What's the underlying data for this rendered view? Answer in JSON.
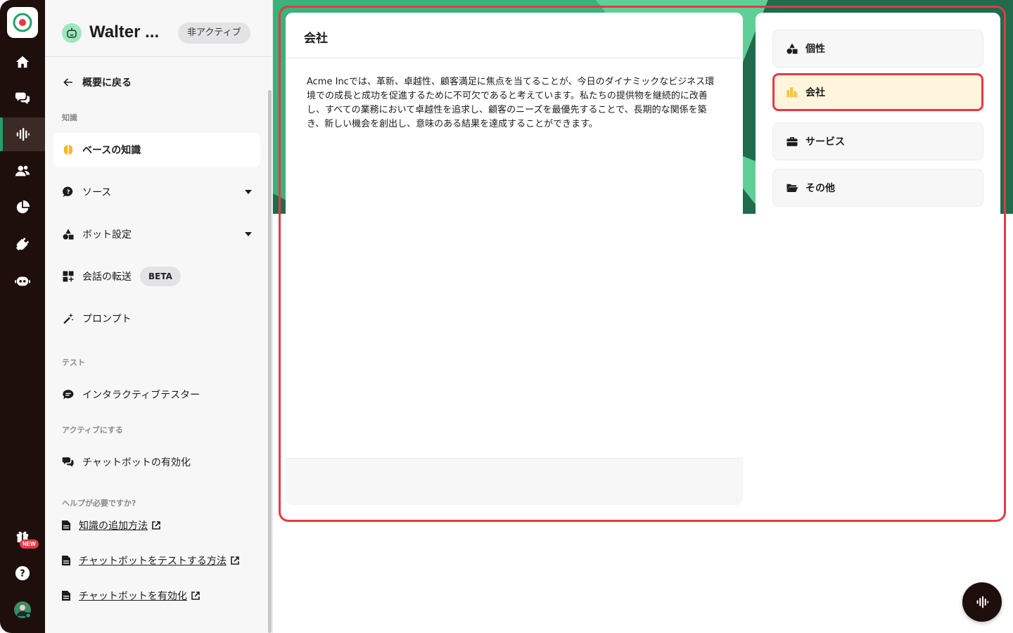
{
  "colors": {
    "rail_bg": "#1e0f0c",
    "accent_green": "#21a366",
    "highlight_red": "#e53944",
    "selected_bg": "#fff5dd"
  },
  "rail": {
    "items": [
      {
        "name": "home-icon"
      },
      {
        "name": "chat-bubbles-icon"
      },
      {
        "name": "waveform-icon",
        "active": true
      },
      {
        "name": "users-icon"
      },
      {
        "name": "pie-chart-icon"
      },
      {
        "name": "plug-icon"
      },
      {
        "name": "robot-icon"
      }
    ],
    "gift_badge": "NEW",
    "help_icon": "question-icon",
    "avatar": "user-avatar"
  },
  "sidebar": {
    "bot_name": "Walter ...",
    "status": "非アクティブ",
    "back_label": "概要に戻る",
    "section_knowledge": "知識",
    "items": {
      "base_knowledge": "ベースの知識",
      "sources": "ソース",
      "bot_settings": "ボット設定",
      "handoff": "会話の転送",
      "handoff_badge": "BETA",
      "prompt": "プロンプト"
    },
    "section_test": "テスト",
    "tester": "インタラクティブテスター",
    "section_activate": "アクティブにする",
    "activate": "チャットボットの有効化",
    "section_help": "ヘルプが必要ですか?",
    "help_links": [
      "知識の追加方法",
      "チャットボットをテストする方法",
      "チャットボットを有効化"
    ]
  },
  "content": {
    "title": "会社",
    "body": "Acme Incでは、革新、卓越性、顧客満足に焦点を当てることが、今日のダイナミックなビジネス環境での成長と成功を促進するために不可欠であると考えています。私たちの提供物を継続的に改善し、すべての業務において卓越性を追求し、顧客のニーズを最優先することで、長期的な関係を築き、新しい機会を創出し、意味のある結果を達成することができます。"
  },
  "nav": {
    "items": [
      {
        "label": "個性",
        "icon": "shapes-icon"
      },
      {
        "label": "会社",
        "icon": "buildings-icon",
        "selected": true
      },
      {
        "label": "サービス",
        "icon": "briefcase-icon"
      },
      {
        "label": "その他",
        "icon": "folder-icon"
      }
    ]
  }
}
